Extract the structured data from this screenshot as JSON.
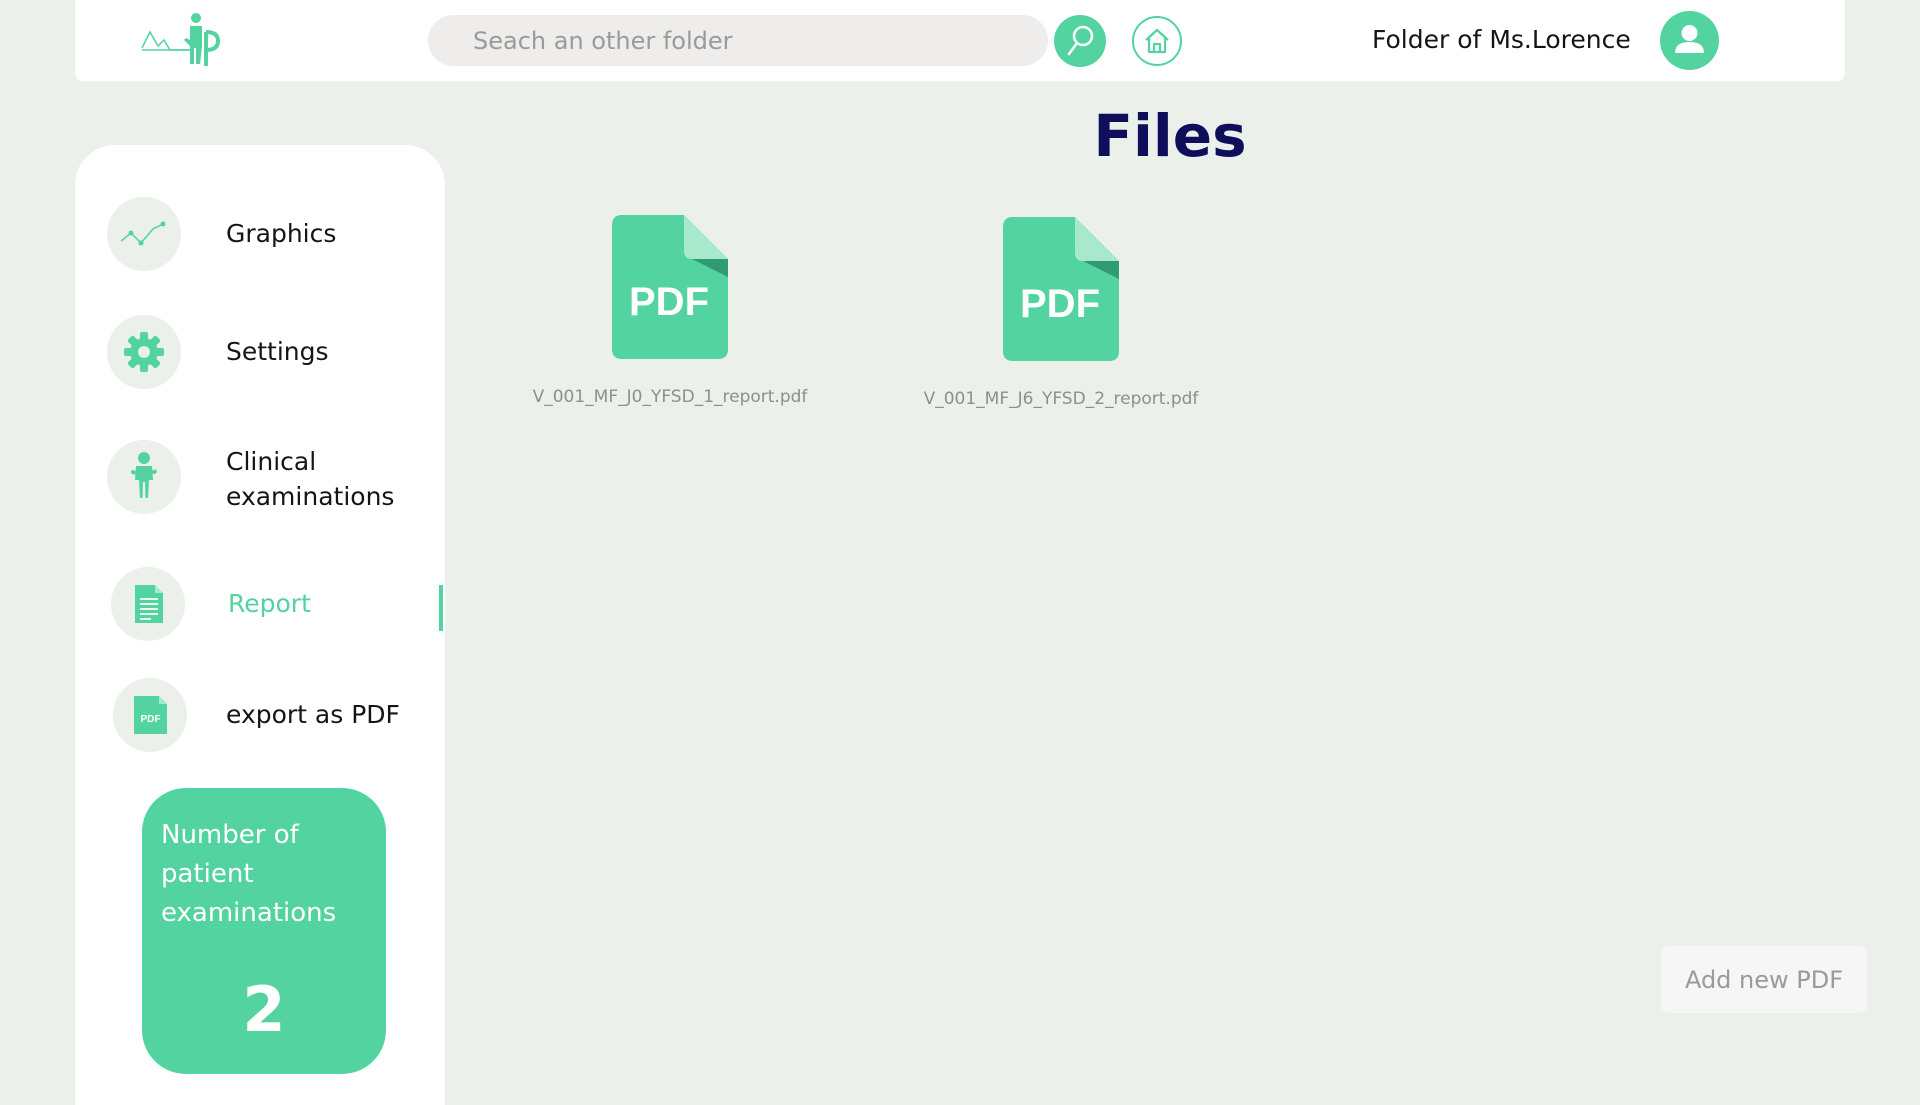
{
  "header": {
    "search_placeholder": "Seach an other folder",
    "folder_of_label": "Folder of",
    "patient_name": "Ms.Lorence"
  },
  "page": {
    "title": "Files"
  },
  "sidebar": {
    "items": [
      {
        "label": "Graphics",
        "icon": "chart-line-icon"
      },
      {
        "label": "Settings",
        "icon": "gear-icon"
      },
      {
        "label": "Clinical examinations",
        "icon": "person-icon"
      },
      {
        "label": "Report",
        "icon": "document-icon",
        "active": true
      },
      {
        "label": "export as PDF",
        "icon": "pdf-icon"
      }
    ],
    "count_card": {
      "label": "Number of patient examinations",
      "value": "2"
    }
  },
  "files": [
    {
      "name": "V_001_MF_J0_YFSD_1_report.pdf",
      "icon_text": "PDF"
    },
    {
      "name": "V_001_MF_J6_YFSD_2_report.pdf",
      "icon_text": "PDF"
    }
  ],
  "actions": {
    "add_pdf_label": "Add new PDF"
  },
  "colors": {
    "accent": "#52D3A0",
    "background": "#EBF0EA",
    "title": "#0E0E5A",
    "pdf_fold_light": "#A8E8CD",
    "pdf_fold_dark": "#2E9B72"
  }
}
